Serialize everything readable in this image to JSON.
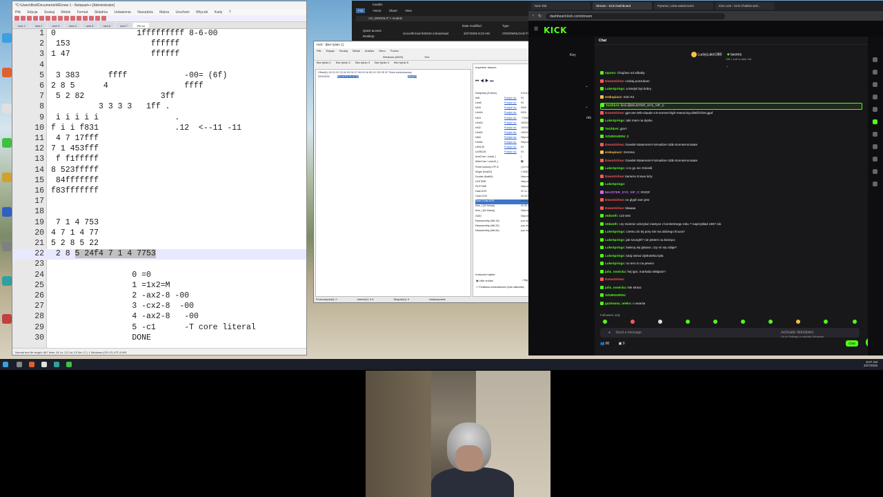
{
  "notepad": {
    "title": "*C:\\Users\\Bod\\Documents\\RE\\new 1 - Notepad++ [Administrator]",
    "menu": [
      "Plik",
      "Edycja",
      "Szukaj",
      "Widok",
      "Format",
      "Składnia",
      "Ustawienia",
      "Narzędzia",
      "Makra",
      "Uruchom",
      "Wtyczki",
      "Karty",
      "?"
    ],
    "tabs": [
      "new 1",
      "new 2",
      "new 3",
      "new 4",
      "new 5",
      "new 6",
      "new 7",
      "RE.txt"
    ],
    "lines": [
      {
        "n": "1",
        "t": "0                 1fffffffff 8-6-00"
      },
      {
        "n": "2",
        "t": " 153                 ffffff"
      },
      {
        "n": "3",
        "t": "1 47                 ffffff"
      },
      {
        "n": "4",
        "t": ""
      },
      {
        "n": "5",
        "t": " 3 383      ffff            -00= (6f)"
      },
      {
        "n": "6",
        "t": "2 8 5      4                ffff"
      },
      {
        "n": "7",
        "t": " 5 2 82                3ff"
      },
      {
        "n": "8",
        "t": "          3 3 3 3   1ff ."
      },
      {
        "n": "9",
        "t": " i i i i i                ."
      },
      {
        "n": "10",
        "t": "f i i f831                .12  <--11 -11"
      },
      {
        "n": "11",
        "t": " 4 7 17fff"
      },
      {
        "n": "12",
        "t": "7 1 453fff"
      },
      {
        "n": "13",
        "t": " f f1fffff"
      },
      {
        "n": "14",
        "t": "8 523fffff"
      },
      {
        "n": "15",
        "t": " 84fffffff"
      },
      {
        "n": "16",
        "t": "f83fffffff"
      },
      {
        "n": "17",
        "t": ""
      },
      {
        "n": "18",
        "t": ""
      },
      {
        "n": "19",
        "t": " 7 1 4 753"
      },
      {
        "n": "20",
        "t": "4 7 1 4 77"
      },
      {
        "n": "21",
        "t": "5 2 8 5 22"
      },
      {
        "n": "22",
        "pre": " 2 8 ",
        "sel": "5 24f4 7 1 4 7753"
      },
      {
        "n": "23",
        "t": ""
      },
      {
        "n": "24",
        "t": "                 0 =0"
      },
      {
        "n": "25",
        "t": "                 1 =1x2=M"
      },
      {
        "n": "26",
        "t": "                 2 -ax2-8 -00"
      },
      {
        "n": "27",
        "t": "                 3 -cx2-8  -00"
      },
      {
        "n": "28",
        "t": "                 4 -ax2-8   -00"
      },
      {
        "n": "29",
        "t": "                 5 -c1      -T core literal"
      },
      {
        "n": "30",
        "t": "                 DONE"
      }
    ],
    "status": "Normal text file          length: 687   lines: 34          Ln: 22  Col: 23  Sel: 17 | 1          Windows (CR LF)   UTF-8         INS"
  },
  "explorer": {
    "title": "models",
    "menu": [
      "File",
      "Home",
      "Share",
      "View"
    ],
    "path": "AO_MONOLIT  >  models",
    "nav": [
      "Quick access",
      "Desktop"
    ],
    "headers": [
      "Name",
      "Date modified",
      "Type"
    ],
    "file": {
      "name": "Unconfirmed 940344.crdownload",
      "date": "3/27/2026 8:23 AM",
      "type": "CRDOWNLOAD File"
    }
  },
  "hxd": {
    "title": "HxD - [Bez tytułu 1]",
    "menu": [
      "Plik",
      "Edycja",
      "Szukaj",
      "Widok",
      "Analiza",
      "Okno",
      "Pomoc"
    ],
    "tabs": [
      "Bez tytułu 1",
      "Bez tytułu 2",
      "Bez tytułu 3",
      "Bez tytułu 4",
      "Bez tytułu 5"
    ],
    "charset": "Windows (ANSI)",
    "radix": "Hex",
    "hexheader": "Offset(h)  00 01 02 03 04 05 06 07 08 09 0A 0B 0C 0D 0E 0F   Tekst zdekodowany",
    "offset": "00000000",
    "selection": "5D 24 F4 71 47 53",
    "decoded": "]$ôqGS",
    "inspector_title": "Inspektor danych",
    "inspector": [
      {
        "k": "Dwójkowy (8 bitów)",
        "lk": "",
        "v": "01011101"
      },
      {
        "k": "Int8",
        "lk": "Przejdź do:",
        "v": "93"
      },
      {
        "k": "UInt8",
        "lk": "Przejdź do:",
        "v": "93"
      },
      {
        "k": "Int16",
        "lk": "Przejdź do:",
        "v": "9309"
      },
      {
        "k": "UInt16",
        "lk": "Przejdź do:",
        "v": "9309"
      },
      {
        "k": "Int24",
        "lk": "Przejdź do:",
        "v": "-778403"
      },
      {
        "k": "UInt24",
        "lk": "Przejdź do:",
        "v": "16003933"
      },
      {
        "k": "Int32",
        "lk": "Przejdź do:",
        "v": "1903436893"
      },
      {
        "k": "UInt32",
        "lk": "Przejdź do:",
        "v": "1903436893"
      },
      {
        "k": "Int64",
        "lk": "Przejdź do:",
        "v": "Nieprawidłowy"
      },
      {
        "k": "UInt64",
        "lk": "Przejdź do:",
        "v": "Nieprawidłowy"
      },
      {
        "k": "LEB128",
        "lk": "Przejdź do:",
        "v": "93"
      },
      {
        "k": "ULEB128",
        "lk": "Przejdź do:",
        "v": "93"
      },
      {
        "k": "AnsiChar / char8_t",
        "lk": "",
        "v": "]"
      },
      {
        "k": "WideChar / char16_t",
        "lk": "",
        "v": "⑝"
      },
      {
        "k": "Punkt kodowy UTF-8",
        "lk": "",
        "v": "] (U+005D)"
      },
      {
        "k": "Single (float32)",
        "lk": "",
        "v": "1,90625066E+30"
      },
      {
        "k": "Double (float64)",
        "lk": "",
        "v": "Nieprawidłowy"
      },
      {
        "k": "OLETIME",
        "lk": "",
        "v": "Nieprawidłowy"
      },
      {
        "k": "FILETIME",
        "lk": "",
        "v": "Nieprawidłowy"
      },
      {
        "k": "Data DOS",
        "lk": "",
        "v": "02.12.2016"
      },
      {
        "k": "Czas DOS",
        "lk": "",
        "v": "04:34:58"
      },
      {
        "k": "Data i Czas DOS",
        "lk": "",
        "v": "20.03.2036 04:34:58"
      },
      {
        "k": "time_t (32 bitowy)",
        "lk": "",
        "v": "02.05.2030 05:08:13"
      },
      {
        "k": "time_t (64 bitowy)",
        "lk": "",
        "v": "Nieprawidłowy"
      },
      {
        "k": "GUID",
        "lk": "",
        "v": "Nieprawidłowy"
      },
      {
        "k": "Disassembly (x86-16)",
        "lk": "",
        "v": "pop bp"
      },
      {
        "k": "Disassembly (x86-32)",
        "lk": "",
        "v": "pop ebp"
      },
      {
        "k": "Disassembly (x86-64)",
        "lk": "",
        "v": "pop rbp"
      }
    ],
    "byteorder": "Kolejność bajtów",
    "little": "Little endian",
    "big": "Big endian",
    "hexinteger": "Podstawa szesnastkowa (nota całkowita)",
    "status": [
      "Przesunięcie(h): 0",
      "Zakres(h): 0-5",
      "Długość(h): 6",
      "Nadpisywanie"
    ]
  },
  "browser": {
    "tabs": [
      "New Tab",
      "Stream - Kick Dashboard",
      "Pytania | Lista wiadomości",
      "Kick.com - Kick Chatbot and..."
    ],
    "url": "dashboard.kick.com/stream",
    "logo": "KICK",
    "sidebar_items": [
      "Key",
      "rds"
    ],
    "chat_title": "Chat",
    "gift_user": "LuckyLuke1980",
    "gift_target": "tworms",
    "gift_sub": "Gift 1 sub to take 3rd",
    "messages": [
      {
        "u": "sqomo",
        "t": "Chujówo od alibaby",
        "c": "#53fc18"
      },
      {
        "u": "DowoGirlow",
        "t": "czekaj poszukam",
        "c": "#ff5a5a"
      },
      {
        "u": "LukeSprings",
        "t": "a kiedyś był dobry",
        "c": "#53fc18"
      },
      {
        "u": "erekupiusz",
        "t": "Kimi K2",
        "c": "#f6c142"
      },
      {
        "u": "ToOhbAt",
        "t": "kimi @MAJSTER_SYS_VIP_C",
        "c": "#53fc18",
        "hl": true
      },
      {
        "u": "DowoGirlow",
        "t": "gpt-oss-20b-claude-4.5-sonnet-high-reasoning-distill-bf16.gguf",
        "c": "#ff5a5a"
      },
      {
        "u": "LukeSprings",
        "t": "taki mam na dysku",
        "c": "#53fc18"
      },
      {
        "u": "ToOhbAt",
        "t": "gim?",
        "c": "#53fc18"
      },
      {
        "u": "SZUBGURDU",
        "t": "2",
        "c": "#53fc18"
      },
      {
        "u": "DowoGirlow",
        "t": "Goedel-Statement-Formalizer-32B-SonnetAnnotate",
        "c": "#ff5a5a"
      },
      {
        "u": "erekupiusz",
        "t": "Gemma",
        "c": "#f6c142"
      },
      {
        "u": "DowoGirlow",
        "t": "Goedel-Statement-Formalizer-32B-SonnetAnnotate",
        "c": "#ff5a5a"
      },
      {
        "u": "LukeSprings",
        "t": "o to go nie zmienili",
        "c": "#53fc18"
      },
      {
        "u": "DowoGirlow",
        "t": "kamera znowu leży",
        "c": "#ff5a5a"
      },
      {
        "u": "LukeSprings",
        "t": "",
        "c": "#53fc18"
      },
      {
        "u": "MAJSTER_SYS_VIP_C",
        "t": "ROOF",
        "c": "#c86bff"
      },
      {
        "u": "DowoGirlow",
        "t": "no glyph tam jest",
        "c": "#ff5a5a"
      },
      {
        "u": "DowoGirlow",
        "t": "tiitaaaa",
        "c": "#ff5a5a"
      },
      {
        "u": "otdwoth",
        "t": "123 test",
        "c": "#53fc18"
      },
      {
        "u": "otdwoth",
        "t": "czy możesz odczytać matryce z konkretnego roku ? naprzykład 1967 rok",
        "c": "#53fc18"
      },
      {
        "u": "LukeSprings",
        "t": "czemu do tej pory nie ma dobrego linuxa?",
        "c": "#53fc18"
      },
      {
        "u": "LukeSprings",
        "t": "jak szunghl? nie jestem na bieżąco",
        "c": "#53fc18"
      },
      {
        "u": "LukeSprings",
        "t": "świecą się jabane, czy mi się zdaje?",
        "c": "#53fc18"
      },
      {
        "u": "LukeSprings",
        "t": "tutaj nieraz dyskoteka była",
        "c": "#53fc18"
      },
      {
        "u": "LukeSprings",
        "t": "no tero to na pewno",
        "c": "#53fc18"
      },
      {
        "u": "julia_nowicka",
        "t": "hej igor, markaba skłajasz?",
        "c": "#53fc18"
      },
      {
        "u": "DowoGirlow",
        "t": "",
        "c": "#ff5a5a"
      },
      {
        "u": "julia_nowicka",
        "t": "Nie strasz",
        "c": "#53fc18"
      },
      {
        "u": "SZUBGURDU",
        "t": "",
        "c": "#53fc18"
      },
      {
        "u": "gaz0wana_mleko",
        "t": "o wsania",
        "c": "#53fc18"
      }
    ],
    "followers_only": "Followers only",
    "composer_placeholder": "Send a message",
    "chat_button": "Chat",
    "viewers": "00",
    "points": "0",
    "activate_title": "Activate Windows",
    "activate_sub": "Go to Settings to activate Windows."
  },
  "taskbar": {
    "time": "8:07 AM",
    "date": "3/27/2026"
  }
}
